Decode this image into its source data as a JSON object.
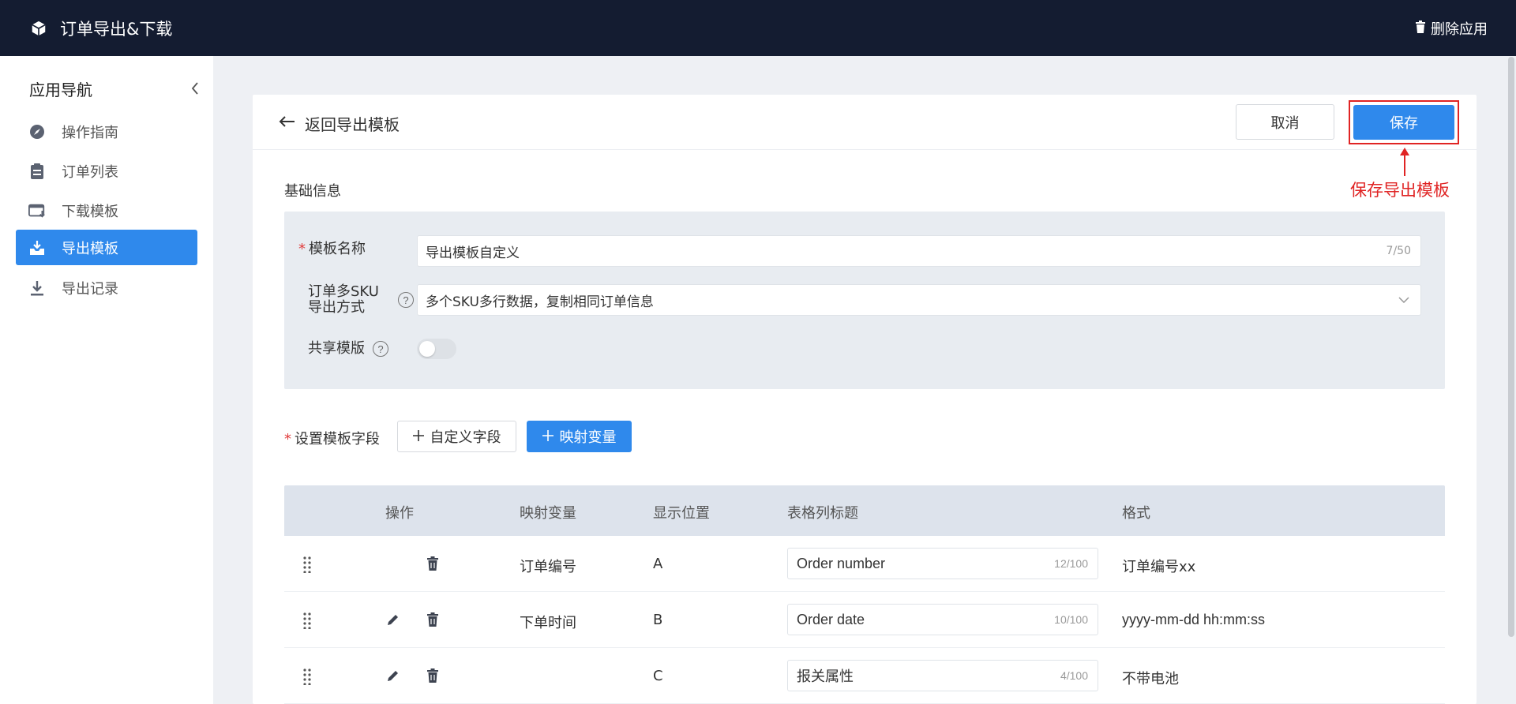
{
  "topbar": {
    "app_title": "订单导出&下载",
    "delete_label": "删除应用"
  },
  "sidebar": {
    "title": "应用导航",
    "items": [
      {
        "label": "操作指南",
        "icon": "compass-icon",
        "active": false
      },
      {
        "label": "订单列表",
        "icon": "clipboard-icon",
        "active": false
      },
      {
        "label": "下载模板",
        "icon": "browser-download-icon",
        "active": false
      },
      {
        "label": "导出模板",
        "icon": "tray-download-icon",
        "active": true
      },
      {
        "label": "导出记录",
        "icon": "download-icon",
        "active": false
      }
    ]
  },
  "header": {
    "back_label": "返回导出模板",
    "cancel_label": "取消",
    "save_label": "保存",
    "annotation": "保存导出模板"
  },
  "basic": {
    "section_title": "基础信息",
    "name_label": "模板名称",
    "name_value": "导出模板自定义",
    "name_count": "7/50",
    "sku_label_line1": "订单多SKU",
    "sku_label_line2": "导出方式",
    "sku_value": "多个SKU多行数据，复制相同订单信息",
    "share_label": "共享模版",
    "help_glyph": "?"
  },
  "fields": {
    "label": "设置模板字段",
    "custom_button": "自定义字段",
    "map_button": "映射变量"
  },
  "table": {
    "headers": [
      "操作",
      "映射变量",
      "显示位置",
      "表格列标题",
      "格式"
    ],
    "rows": [
      {
        "variable": "订单编号",
        "position": "A",
        "title": "Order number",
        "count": "12/100",
        "format": "订单编号xx",
        "editable": false
      },
      {
        "variable": "下单时间",
        "position": "B",
        "title": "Order date",
        "count": "10/100",
        "format": "yyyy-mm-dd hh:mm:ss",
        "editable": true
      },
      {
        "variable": "",
        "position": "C",
        "title": "报关属性",
        "count": "4/100",
        "format": "不带电池",
        "editable": true
      }
    ]
  },
  "colors": {
    "topbar": "#141c31",
    "accent": "#2f89ec",
    "annotation": "#e02424",
    "required": "#e03b3b"
  }
}
